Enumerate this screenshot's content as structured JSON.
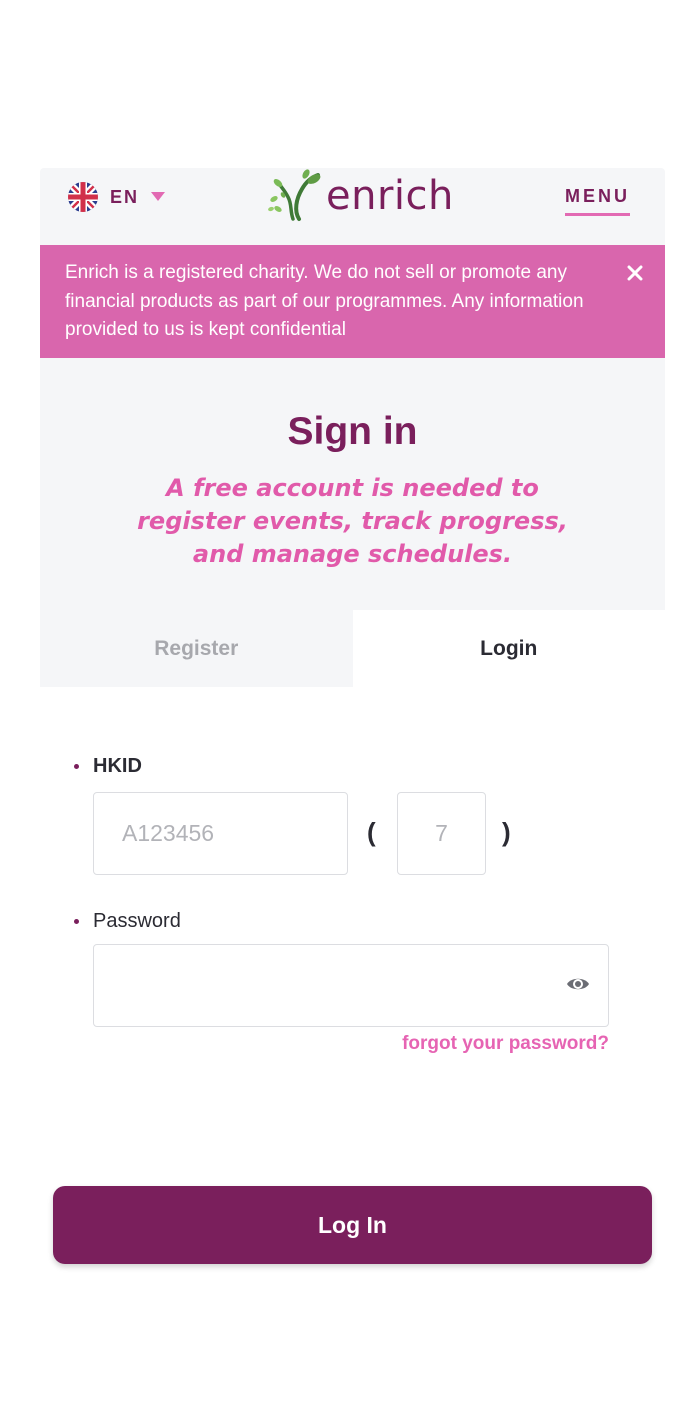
{
  "header": {
    "language": "EN",
    "brand": "enrich",
    "menu_label": "MENU"
  },
  "banner": {
    "text": "Enrich is a registered charity. We do not sell or promote any financial products as part of our programmes. Any information provided to us is kept confidential"
  },
  "signin": {
    "title": "Sign in",
    "subtitle": "A free account is needed to register events, track progress, and manage schedules."
  },
  "tabs": [
    {
      "label": "Register",
      "active": false
    },
    {
      "label": "Login",
      "active": true
    }
  ],
  "form": {
    "hkid_label": "HKID",
    "hkid_placeholder": "A123456",
    "check_digit_placeholder": "7",
    "paren_open": "(",
    "paren_close": ")",
    "password_label": "Password",
    "password_value": "",
    "forgot_link": "forgot your password?",
    "submit_label": "Log In"
  },
  "colors": {
    "brand": "#7a1f5c",
    "accent_pink": "#d966ad",
    "link_pink": "#e664b3",
    "panel_bg": "#f5f6f8"
  },
  "icons": [
    "uk-flag-icon",
    "caret-down-icon",
    "enrich-logo-icon",
    "close-icon",
    "eye-icon"
  ]
}
